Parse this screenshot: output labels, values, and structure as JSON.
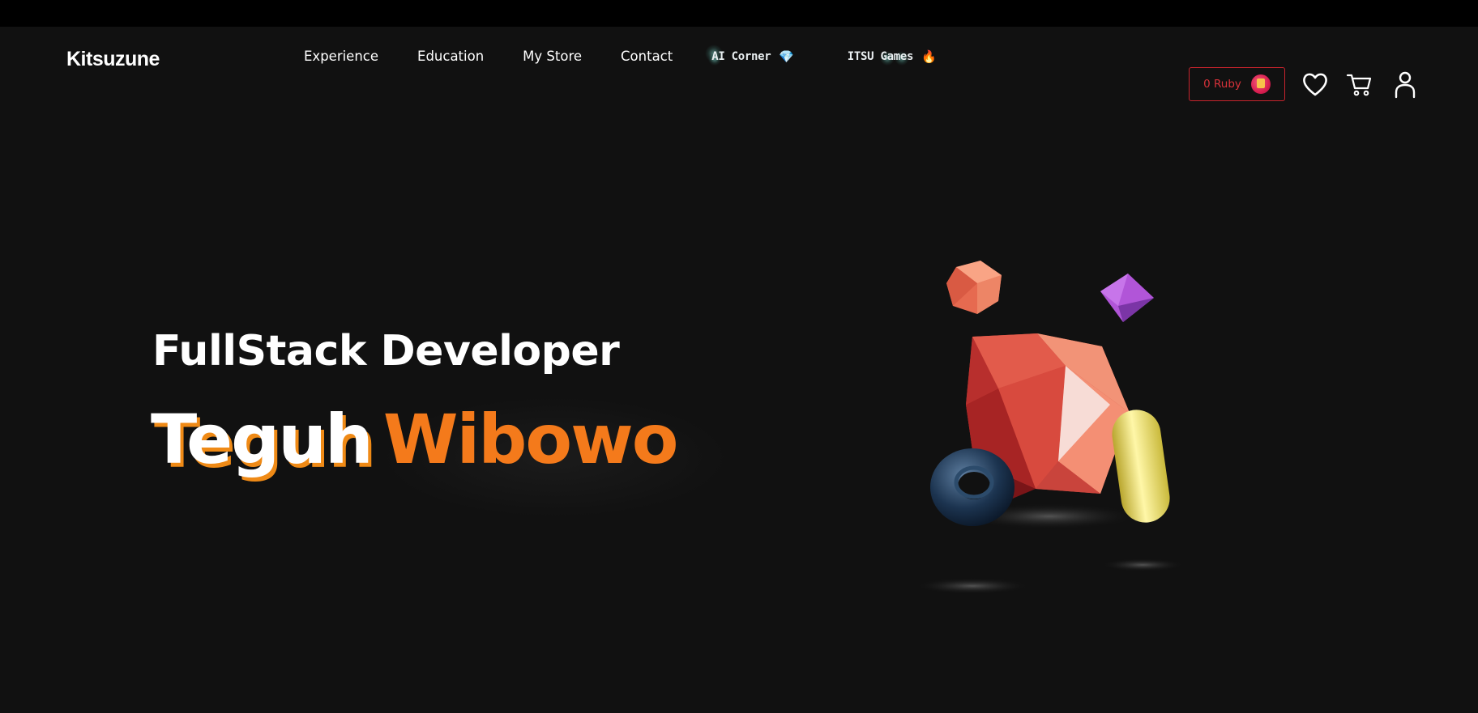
{
  "header": {
    "logo": "Kitsuzune",
    "nav": [
      {
        "label": "Experience"
      },
      {
        "label": "Education"
      },
      {
        "label": "My Store"
      },
      {
        "label": "Contact"
      }
    ],
    "special_nav": [
      {
        "label": "AI Corner",
        "icon": "gem-icon",
        "emoji": "💎"
      },
      {
        "label": "ITSU Games",
        "icon": "fire-icon",
        "emoji": "🔥"
      }
    ],
    "ruby": {
      "label": "0 Ruby",
      "icon": "ruby-coin-icon"
    },
    "icons": [
      "heart-icon",
      "cart-icon",
      "user-icon"
    ]
  },
  "hero": {
    "subtitle": "FullStack Developer",
    "first_name": "Teguh",
    "last_name": "Wibowo"
  },
  "colors": {
    "background": "#111111",
    "accent_orange": "#f47a1b",
    "ruby_red": "#c8242d"
  }
}
